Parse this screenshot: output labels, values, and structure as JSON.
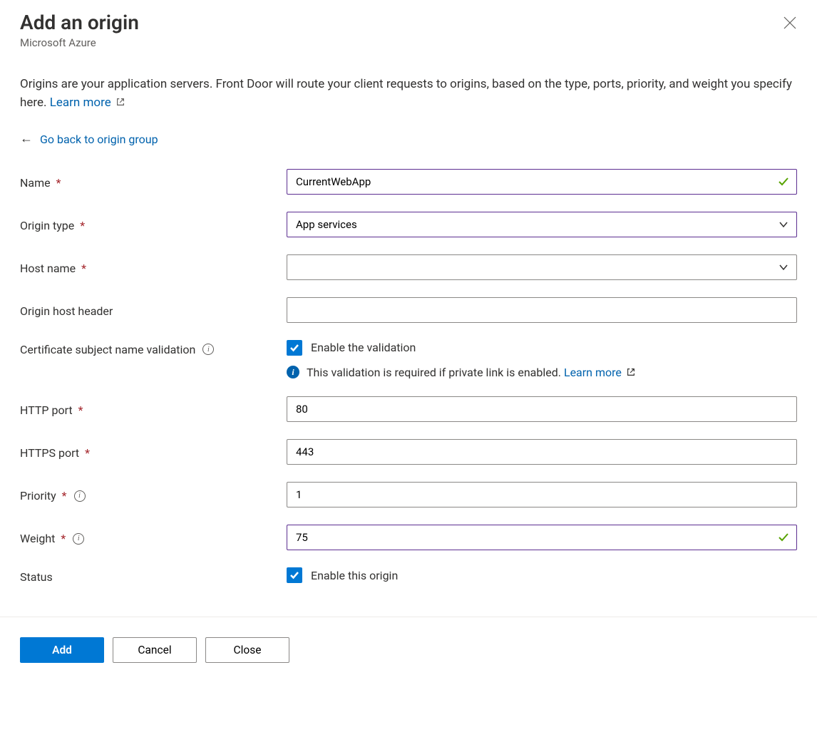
{
  "header": {
    "title": "Add an origin",
    "subtitle": "Microsoft Azure"
  },
  "intro": {
    "text": "Origins are your application servers. Front Door will route your client requests to origins, based on the type, ports, priority, and weight you specify here. ",
    "learn_more": "Learn more"
  },
  "backlink": {
    "label": "Go back to origin group"
  },
  "fields": {
    "name": {
      "label": "Name",
      "value": "CurrentWebApp",
      "validated": true
    },
    "origin_type": {
      "label": "Origin type",
      "value": "App services",
      "validated": true
    },
    "host_name": {
      "label": "Host name",
      "value": ""
    },
    "origin_host_header": {
      "label": "Origin host header",
      "value": ""
    },
    "cert_validation": {
      "label": "Certificate subject name validation",
      "checkbox_label": "Enable the validation",
      "checked": true,
      "message": "This validation is required if private link is enabled. ",
      "learn_more": "Learn more"
    },
    "http_port": {
      "label": "HTTP port",
      "value": "80"
    },
    "https_port": {
      "label": "HTTPS port",
      "value": "443"
    },
    "priority": {
      "label": "Priority",
      "value": "1"
    },
    "weight": {
      "label": "Weight",
      "value": "75",
      "validated": true
    },
    "status": {
      "label": "Status",
      "checkbox_label": "Enable this origin",
      "checked": true
    }
  },
  "footer": {
    "add": "Add",
    "cancel": "Cancel",
    "close": "Close"
  }
}
